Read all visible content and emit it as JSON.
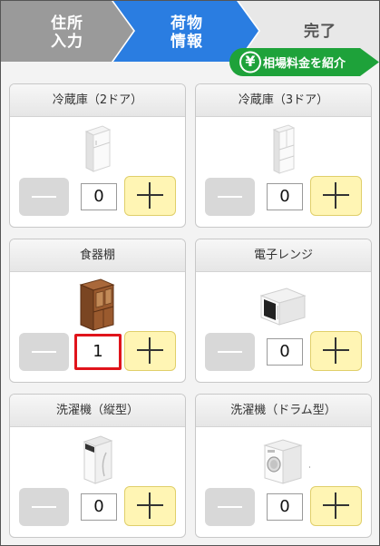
{
  "steps": [
    {
      "label": "住所\n入力",
      "state": "done",
      "color": "#9a9a9a"
    },
    {
      "label": "荷物\n情報",
      "state": "current",
      "color": "#2a7de1"
    },
    {
      "label": "完了",
      "state": "todo",
      "color": "#e8e8e8"
    }
  ],
  "quote_button": {
    "yen_symbol": "¥",
    "label": "相場料金を紹介",
    "color": "#1ea23a"
  },
  "items": [
    {
      "name": "冷蔵庫（2ドア）",
      "quantity": "0",
      "icon": "fridge-2door-icon"
    },
    {
      "name": "冷蔵庫（3ドア）",
      "quantity": "0",
      "icon": "fridge-3door-icon"
    },
    {
      "name": "食器棚",
      "quantity": "1",
      "icon": "cupboard-icon"
    },
    {
      "name": "電子レンジ",
      "quantity": "0",
      "icon": "microwave-icon"
    },
    {
      "name": "洗濯機（縦型）",
      "quantity": "0",
      "icon": "washer-vertical-icon"
    },
    {
      "name": "洗濯機（ドラム型）",
      "quantity": "0",
      "icon": "washer-drum-icon"
    }
  ],
  "colors": {
    "minus_button": "#d8d8d8",
    "plus_button": "#fff5b4",
    "highlight_border": "#e0141b"
  }
}
